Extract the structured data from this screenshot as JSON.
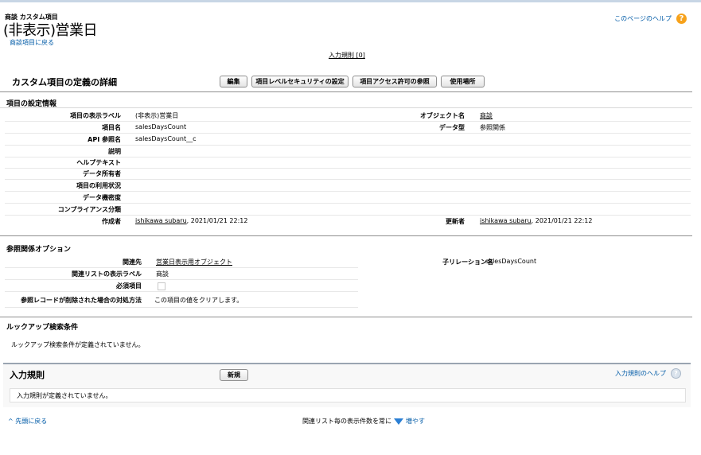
{
  "header": {
    "breadcrumb": "商談 カスタム項目",
    "title": "(非表示)営業日",
    "back_link": "商談項目に戻る",
    "help_link": "このページのヘルプ",
    "validation_link": "入力規則 [0]"
  },
  "detail": {
    "title": "カスタム項目の定義の詳細",
    "buttons": {
      "edit": "編集",
      "field_security": "項目レベルセキュリティの設定",
      "field_access": "項目アクセス許可の参照",
      "where_used": "使用場所"
    }
  },
  "field_info": {
    "section_title": "項目の設定情報",
    "left": [
      {
        "label": "項目の表示ラベル",
        "value": "(非表示)営業日"
      },
      {
        "label": "項目名",
        "value": "salesDaysCount"
      },
      {
        "label": "API 参照名",
        "value": "salesDaysCount__c"
      },
      {
        "label": "説明",
        "value": ""
      },
      {
        "label": "ヘルプテキスト",
        "value": ""
      },
      {
        "label": "データ所有者",
        "value": ""
      },
      {
        "label": "項目の利用状況",
        "value": ""
      },
      {
        "label": "データ機密度",
        "value": ""
      },
      {
        "label": "コンプライアンス分類",
        "value": ""
      },
      {
        "label": "作成者",
        "value": "ishikawa subaru",
        "extra": ", 2021/01/21 22:12"
      }
    ],
    "right": [
      {
        "label": "オブジェクト名",
        "value": "商談"
      },
      {
        "label": "データ型",
        "value": "参照関係"
      },
      {
        "label": "更新者",
        "value": "ishikawa subaru",
        "extra": ", 2021/01/21 22:12"
      }
    ]
  },
  "lookup_options": {
    "section_title": "参照関係オプション",
    "related_to_label": "関連先",
    "related_to_value": "営業日表示用オブジェクト",
    "related_list_label": "関連リストの表示ラベル",
    "related_list_value": "商談",
    "required_label": "必須項目",
    "delete_label": "参照レコードが削除された場合の対処方法",
    "delete_value": "この項目の値をクリアします。",
    "child_rel_label": "子リレーション名",
    "child_rel_value": "salesDaysCount"
  },
  "lookup_filter": {
    "section_title": "ルックアップ検索条件",
    "empty_text": "ルックアップ検索条件が定義されていません。"
  },
  "validation_rules": {
    "title": "入力規則",
    "new_button": "新規",
    "help_link": "入力規則のヘルプ",
    "empty_text": "入力規則が定義されていません。"
  },
  "footer": {
    "back_to_top": "先頭に戻る",
    "related_text": "関連リスト毎の表示件数を常に",
    "increase": "増やす"
  }
}
